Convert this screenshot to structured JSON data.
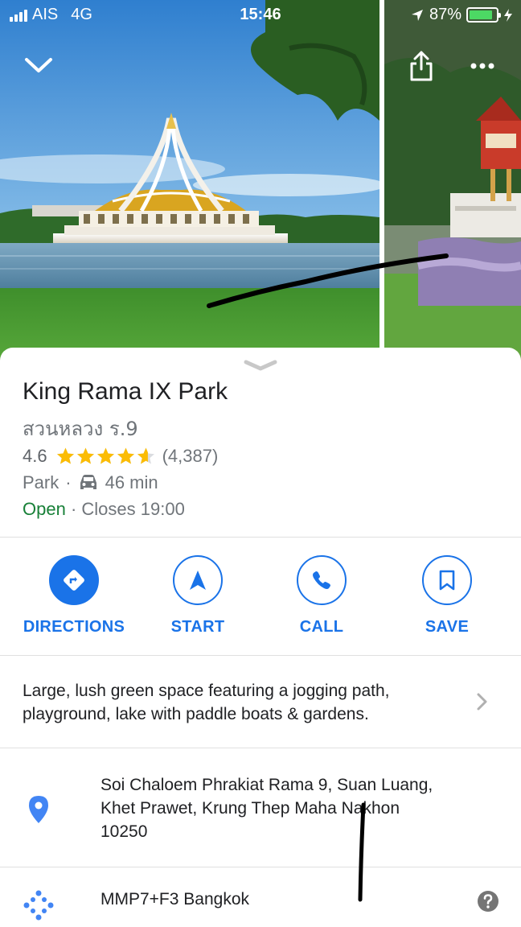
{
  "status_bar": {
    "carrier": "AIS",
    "network": "4G",
    "time": "15:46",
    "battery_percent": "87%",
    "battery_level": 0.87
  },
  "header": {
    "collapse_icon": "chevron-down-icon",
    "share_icon": "share-icon",
    "more_icon": "more-horizontal-icon"
  },
  "place": {
    "name": "King Rama IX Park",
    "local_name": "สวนหลวง ร.9",
    "rating": "4.6",
    "rating_value": 4.6,
    "review_count": "(4,387)",
    "category": "Park",
    "separator": "·",
    "drive_time": "46 min",
    "status": "Open",
    "hours": "· Closes 19:00"
  },
  "actions": [
    {
      "label": "DIRECTIONS",
      "icon": "directions-icon"
    },
    {
      "label": "START",
      "icon": "navigation-arrow-icon"
    },
    {
      "label": "CALL",
      "icon": "phone-icon"
    },
    {
      "label": "SAVE",
      "icon": "bookmark-icon"
    }
  ],
  "description": "Large, lush green space featuring a jogging path, playground, lake with paddle boats & gardens.",
  "address": {
    "lines": [
      "Soi Chaloem Phrakiat Rama 9, Suan Luang,",
      "Khet Prawet, Krung Thep Maha Nakhon",
      "10250"
    ]
  },
  "plus_code": "MMP7+F3 Bangkok",
  "colors": {
    "accent": "#1a73e8",
    "open": "#188038",
    "star": "#fbbc04",
    "pin": "#4285f4"
  }
}
